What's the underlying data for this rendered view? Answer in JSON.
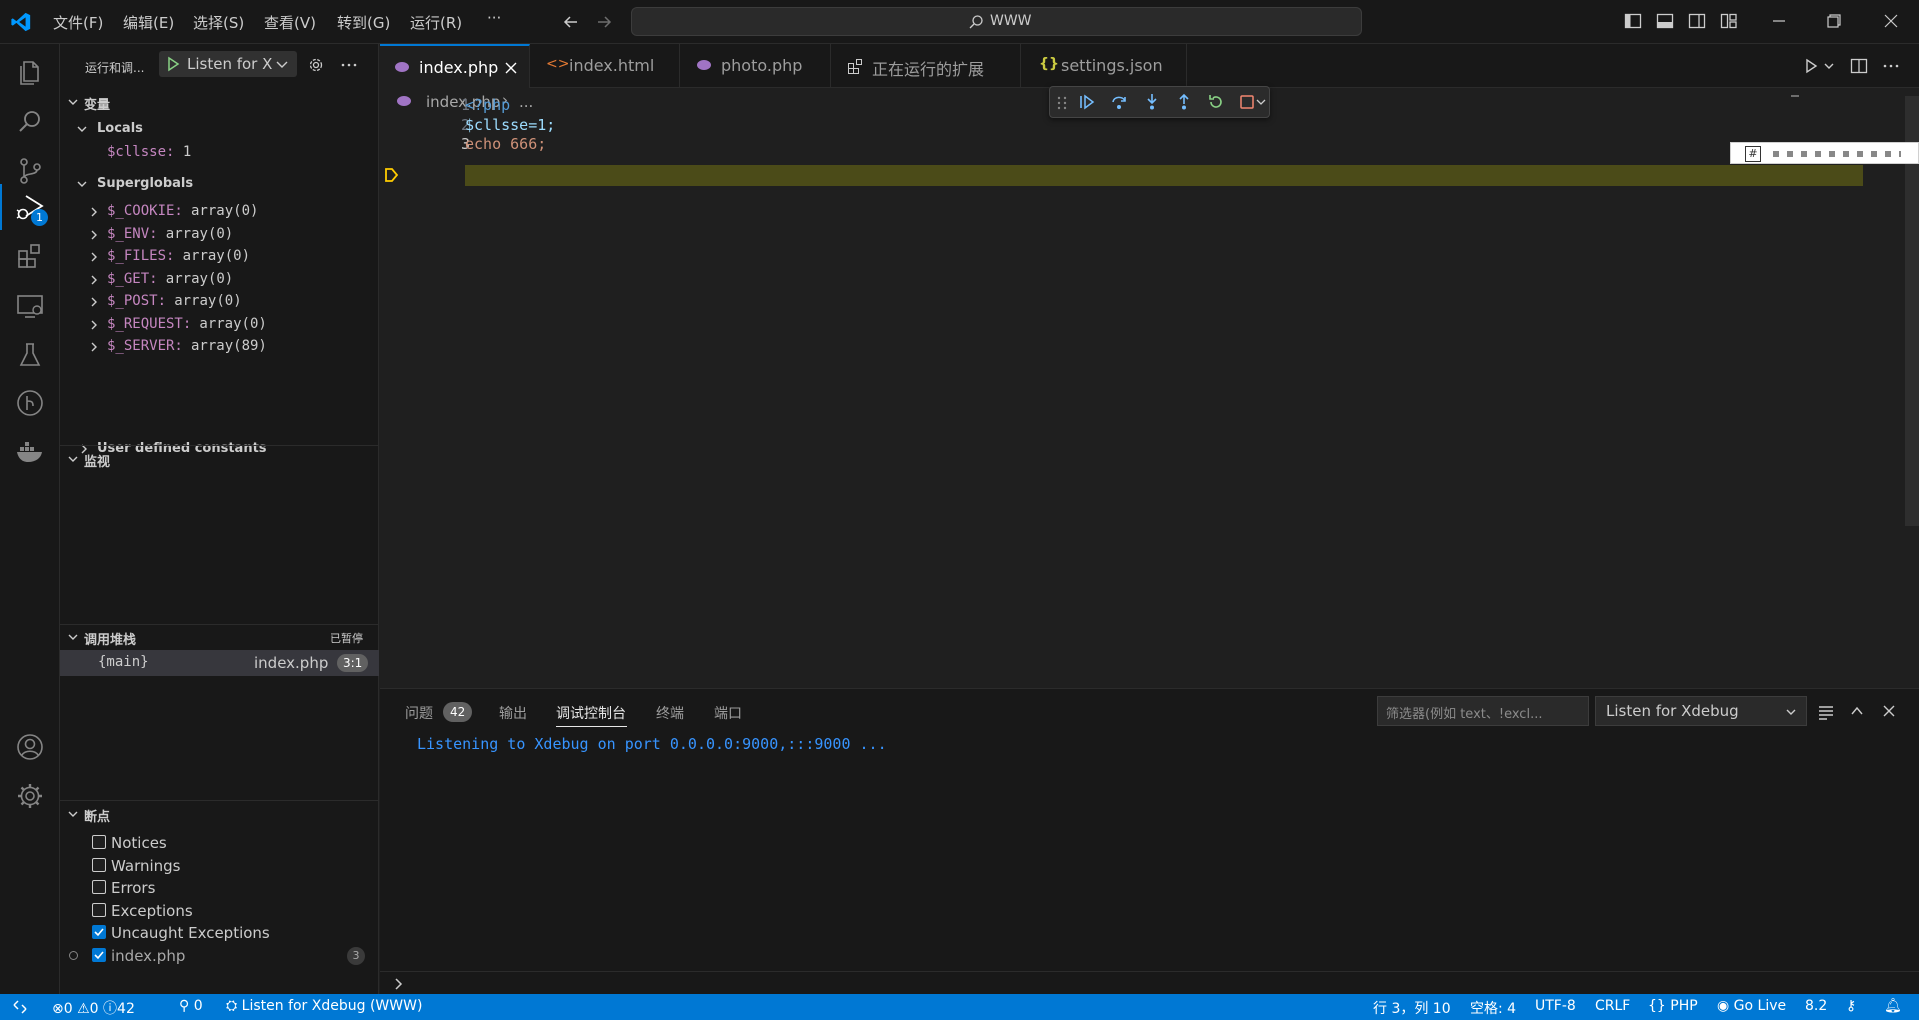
{
  "menu": [
    "文件(F)",
    "编辑(E)",
    "选择(S)",
    "查看(V)",
    "转到(G)",
    "运行(R)",
    "···"
  ],
  "search": {
    "text": "WWW"
  },
  "sidebar": {
    "title": "运行和调...",
    "config": "Listen for X",
    "variables_header": "变量",
    "locals_header": "Locals",
    "locals": [
      {
        "name": "$cllsse:",
        "value": "1"
      }
    ],
    "superglobals_header": "Superglobals",
    "superglobals": [
      {
        "name": "$_COOKIE:",
        "value": "array(0)"
      },
      {
        "name": "$_ENV:",
        "value": "array(0)"
      },
      {
        "name": "$_FILES:",
        "value": "array(0)"
      },
      {
        "name": "$_GET:",
        "value": "array(0)"
      },
      {
        "name": "$_POST:",
        "value": "array(0)"
      },
      {
        "name": "$_REQUEST:",
        "value": "array(0)"
      },
      {
        "name": "$_SERVER:",
        "value": "array(89)"
      }
    ],
    "user_constants": "User defined constants",
    "watch_header": "监视",
    "callstack_header": "调用堆栈",
    "callstack_status": "已暂停",
    "callstack": [
      {
        "frame": "{main}",
        "file": "index.php",
        "pos": "3:1"
      }
    ],
    "breakpoints_header": "断点",
    "breakpoints": [
      {
        "label": "Notices",
        "checked": false
      },
      {
        "label": "Warnings",
        "checked": false
      },
      {
        "label": "Errors",
        "checked": false
      },
      {
        "label": "Exceptions",
        "checked": false
      },
      {
        "label": "Uncaught Exceptions",
        "checked": true
      },
      {
        "label": "index.php",
        "checked": true,
        "count": "3"
      }
    ]
  },
  "tabs": [
    {
      "label": "index.php",
      "active": true
    },
    {
      "label": "index.html",
      "active": false
    },
    {
      "label": "photo.php",
      "active": false
    },
    {
      "label": "正在运行的扩展",
      "active": false
    },
    {
      "label": "settings.json",
      "active": false
    }
  ],
  "breadcrumb": {
    "file": "index.php",
    "more": "..."
  },
  "code": [
    {
      "line": "1",
      "text": "<?php"
    },
    {
      "line": "2",
      "text": "$cllsse=1;"
    },
    {
      "line": "3",
      "text": "echo 666;"
    }
  ],
  "panel": {
    "tabs": [
      "问题",
      "输出",
      "调试控制台",
      "终端",
      "端口"
    ],
    "problems_count": "42",
    "active_tab": "调试控制台",
    "filter_placeholder": "筛选器(例如 text、!excl...",
    "config": "Listen for Xdebug",
    "output": "Listening to Xdebug on port 0.0.0.0:9000,:::9000 ..."
  },
  "status": {
    "errors": "0",
    "warnings": "0",
    "info": "42",
    "ports": "0",
    "debug": "Listen for Xdebug (WWW)",
    "position": "行 3，列 10",
    "spaces": "空格: 4",
    "encoding": "UTF-8",
    "eol": "CRLF",
    "language": "PHP",
    "golive": "Go Live",
    "version": "8.2"
  },
  "badges": {
    "debug": "1"
  },
  "colors": {
    "accent": "#0078d4",
    "highlight": "#4b4b18",
    "php_purple": "#a074c4",
    "status_bar": "#0078d4"
  }
}
